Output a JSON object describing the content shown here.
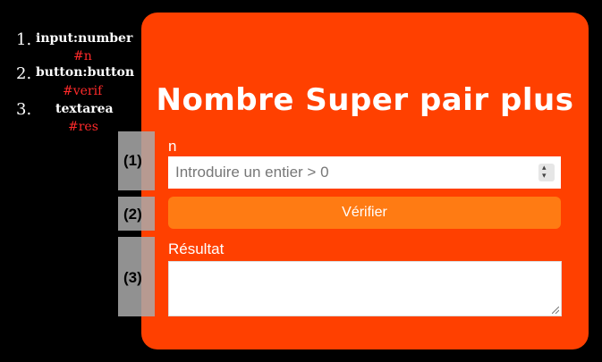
{
  "legend": [
    {
      "num": "1.",
      "type": "input:number",
      "id": "#n"
    },
    {
      "num": "2.",
      "type": "button:button",
      "id": "#verif"
    },
    {
      "num": "3.",
      "type": "textarea",
      "id": "#res"
    }
  ],
  "card": {
    "title": "Nombre Super pair plus",
    "n_label": "n",
    "n_placeholder": "Introduire un entier > 0",
    "verify_label": "Vérifier",
    "result_label": "Résultat",
    "result_value": ""
  },
  "markers": [
    "(1)",
    "(2)",
    "(3)"
  ],
  "colors": {
    "card": "#ff4000",
    "button": "#ff7b13",
    "marker": "#aaaaaa",
    "legend_id": "#ff2a2a"
  }
}
